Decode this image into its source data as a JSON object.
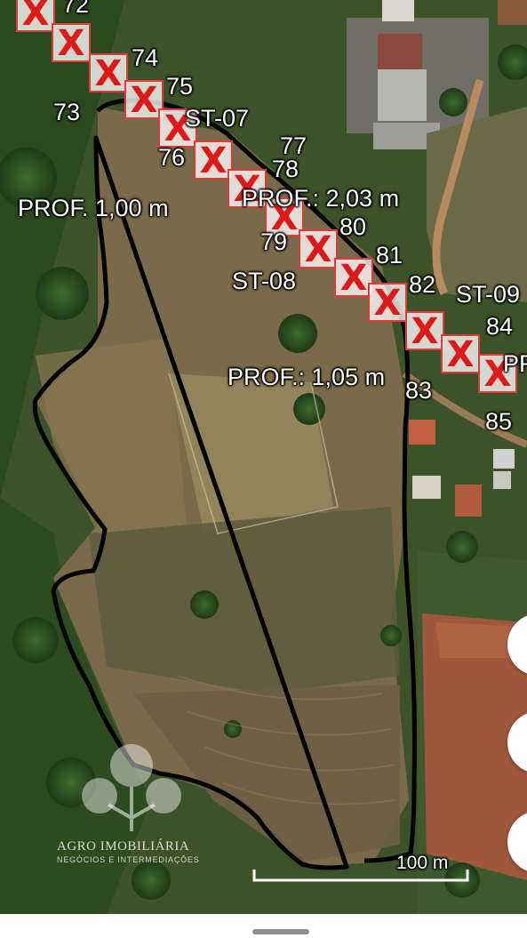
{
  "map": {
    "survey_points": [
      "72",
      "73",
      "74",
      "75",
      "76",
      "77",
      "78",
      "79",
      "80",
      "81",
      "82",
      "83",
      "84",
      "85"
    ],
    "stations": [
      "ST-07",
      "ST-08",
      "ST-09"
    ],
    "depths": [
      "PROF. 1,00 m",
      "PROF.: 2,03 m",
      "PROF.: 1,05 m",
      "PR"
    ],
    "scale_label": "100 m",
    "boundary_color": "#000000",
    "marker_color": "#e01818"
  },
  "watermark": {
    "name": "AGRO IMOBILIÁRIA",
    "tagline": "NEGÓCIOS E INTERMEDIAÇÕES"
  },
  "controls": [
    "map-button-1",
    "map-button-2",
    "map-button-3"
  ]
}
